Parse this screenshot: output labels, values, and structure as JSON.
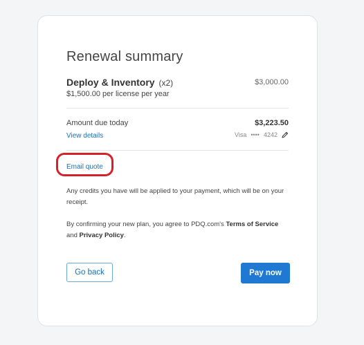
{
  "summary": {
    "title": "Renewal summary",
    "product": {
      "name": "Deploy & Inventory",
      "quantity": "(x2)",
      "subtitle": "$1,500.00 per license per year",
      "price": "$3,000.00"
    },
    "amount": {
      "label": "Amount due today",
      "value": "$3,223.50",
      "view_details": "View details",
      "card_brand": "Visa",
      "card_mask": "••••",
      "card_last4": "4242"
    },
    "email_quote": "Email quote",
    "credits_text": "Any credits you have will be applied to your payment, which will be on your receipt.",
    "terms": {
      "prefix": "By confirming your new plan, you agree to PDQ.com's ",
      "terms_link": "Terms of Service",
      "conjunction": " and ",
      "privacy_link": "Privacy Policy",
      "suffix": "."
    },
    "buttons": {
      "back": "Go back",
      "pay": "Pay now"
    }
  },
  "highlight": {
    "color": "#d3222a",
    "target": "email-quote-link"
  },
  "colors": {
    "accent": "#1f78d1",
    "link": "#1a6fb5"
  },
  "icons": {
    "edit": "pencil-icon"
  }
}
